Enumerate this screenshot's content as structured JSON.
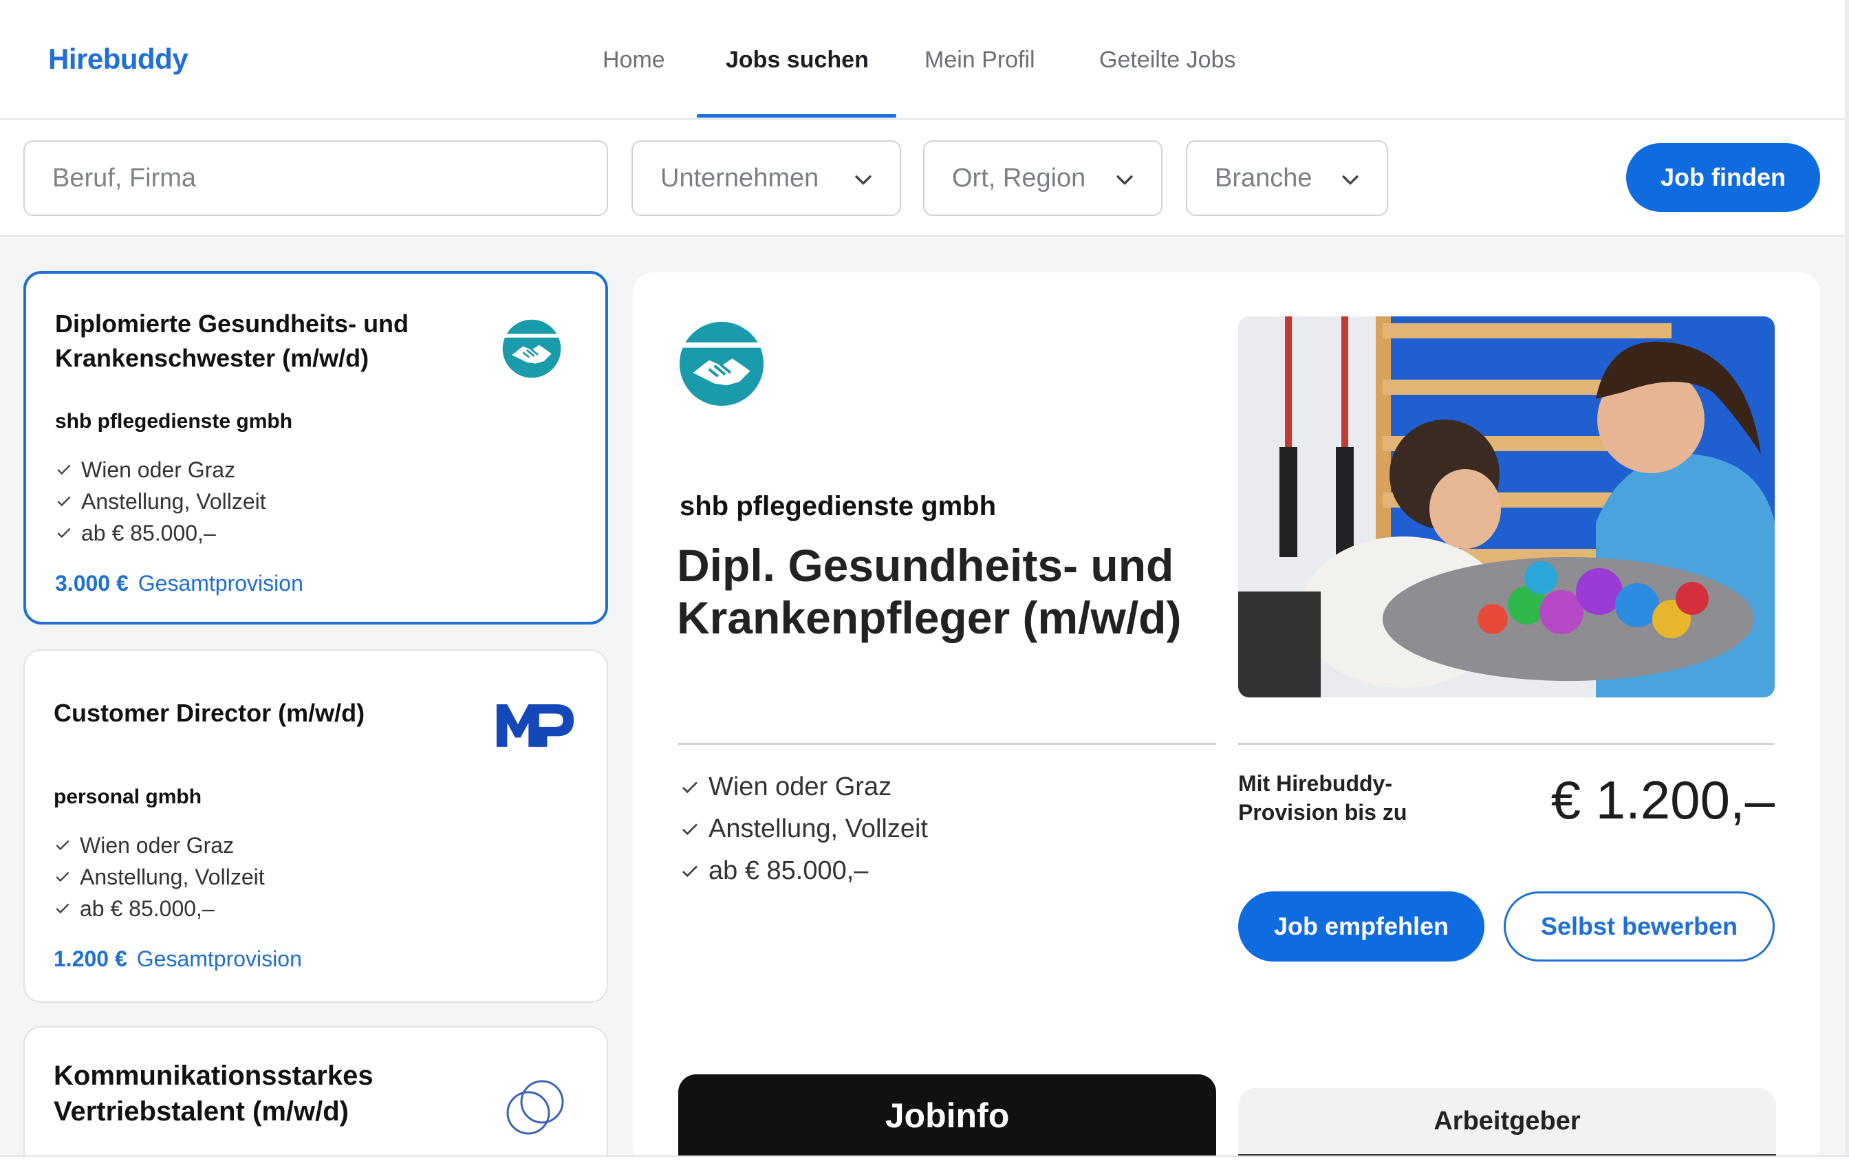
{
  "brand": {
    "name": "Hirebuddy",
    "color": "#1f6fd6"
  },
  "nav": {
    "items": [
      {
        "label": "Home",
        "active": false
      },
      {
        "label": "Jobs suchen",
        "active": true
      },
      {
        "label": "Mein Profil",
        "active": false
      },
      {
        "label": "Geteilte Jobs",
        "active": false
      }
    ]
  },
  "search": {
    "query_placeholder": "Beruf, Firma",
    "company_placeholder": "Unternehmen",
    "location_placeholder": "Ort, Region",
    "industry_placeholder": "Branche",
    "submit_label": "Job finden"
  },
  "jobs": [
    {
      "title": "Diplomierte Gesundheits- und Krankenschwester (m/w/d)",
      "company": "shb pflegedienste gmbh",
      "features": [
        "Wien oder Graz",
        "Anstellung, Vollzeit",
        "ab € 85.000,–"
      ],
      "commission_amount": "3.000 €",
      "commission_label": "Gesamtprovision",
      "logo_icon": "handshake-logo",
      "selected": true
    },
    {
      "title": "Customer Director (m/w/d)",
      "company": "personal gmbh",
      "features": [
        "Wien oder Graz",
        "Anstellung, Vollzeit",
        "ab € 85.000,–"
      ],
      "commission_amount": "1.200 €",
      "commission_label": "Gesamtprovision",
      "logo_icon": "mp-logo",
      "selected": false
    },
    {
      "title": "Kommunikationsstarkes Vertriebstalent (m/w/d)",
      "logo_icon": "rings-logo",
      "selected": false
    }
  ],
  "detail": {
    "company": "shb pflegedienste gmbh",
    "title": "Dipl. Gesundheits- und Krankenpfleger (m/w/d)",
    "features": [
      "Wien oder Graz",
      "Anstellung, Vollzeit",
      "ab € 85.000,–"
    ],
    "commission_label": "Mit Hirebuddy-Provision bis zu",
    "commission_amount": "€ 1.200,–",
    "recommend_label": "Job empfehlen",
    "apply_label": "Selbst bewerben",
    "tabs": [
      {
        "label": "Jobinfo",
        "active": true
      },
      {
        "label": "Arbeitgeber",
        "active": false
      }
    ],
    "logo_icon": "handshake-logo",
    "photo_icon": "therapy-photo"
  },
  "colors": {
    "primary": "#0f6be0",
    "teal": "#1a9bab",
    "navy": "#1447b8",
    "background": "#f4f5f7"
  }
}
